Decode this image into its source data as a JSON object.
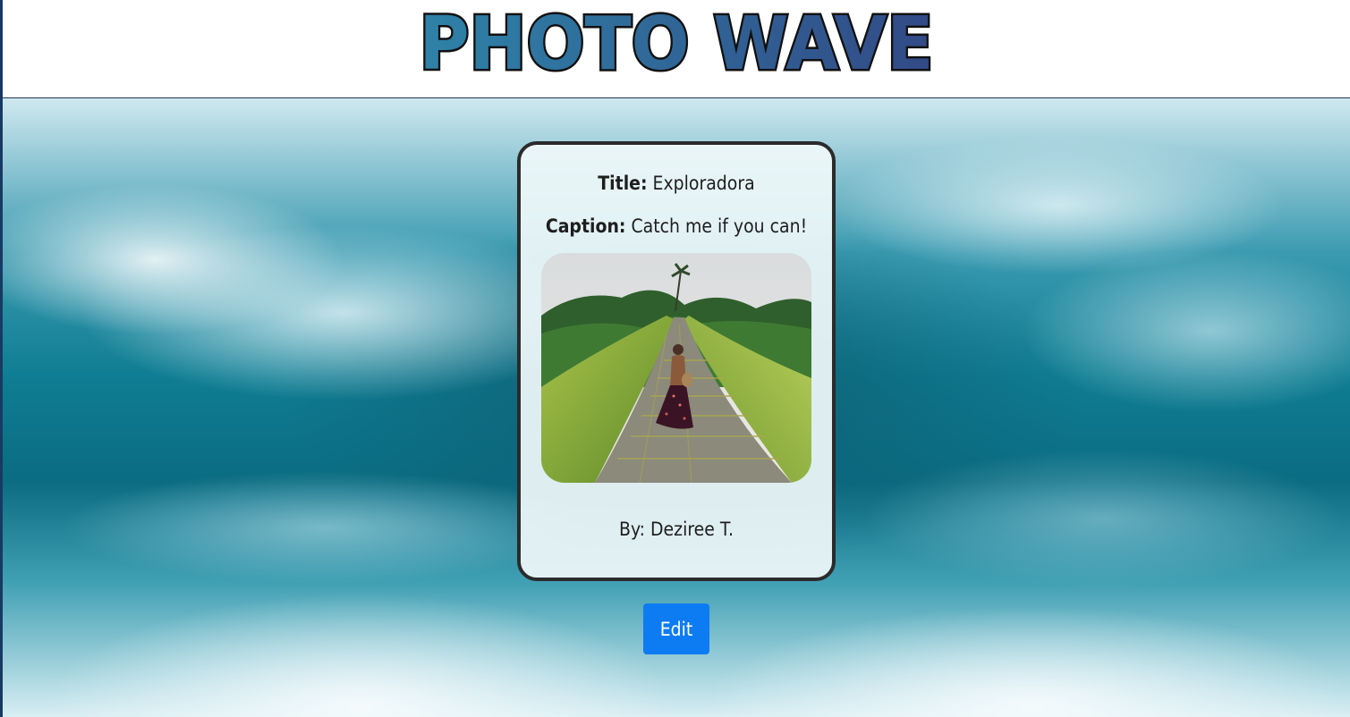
{
  "header": {
    "logo_text": "PHOTO WAVE"
  },
  "colors": {
    "logo_gradient_start": "#2e82a8",
    "logo_gradient_end": "#324a86",
    "edit_button": "#0d7cf2"
  },
  "post": {
    "title_label": "Title:",
    "title_value": "Exploradora",
    "caption_label": "Caption:",
    "caption_value": "Catch me if you can!",
    "author": "By: Deziree T.",
    "image_icon": "photo-woman-on-path"
  },
  "actions": {
    "edit_label": "Edit"
  }
}
